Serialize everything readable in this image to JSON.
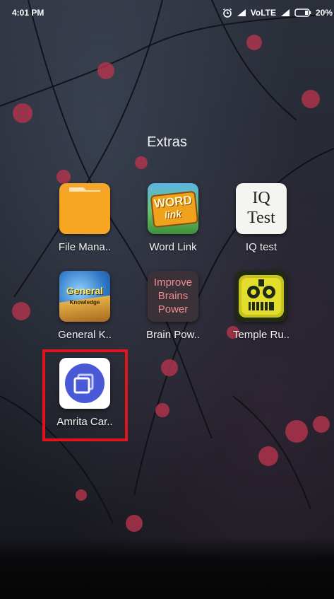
{
  "status_bar": {
    "time": "4:01 PM",
    "network": "VoLTE",
    "battery": "20%"
  },
  "folder": {
    "title": "Extras"
  },
  "apps": [
    {
      "label": "File Mana..",
      "icon": "folder-icon"
    },
    {
      "label": "Word Link",
      "icon": "word-link-icon",
      "icon_text_1": "WORD",
      "icon_text_2": "link"
    },
    {
      "label": "IQ test",
      "icon": "iq-test-icon",
      "icon_text_1": "IQ",
      "icon_text_2": "Test"
    },
    {
      "label": "General K..",
      "icon": "general-knowledge-icon",
      "icon_text_1": "General",
      "icon_text_2": "Knowledge"
    },
    {
      "label": "Brain Pow..",
      "icon": "brain-power-icon",
      "icon_text_1": "Improve",
      "icon_text_2": "Brains",
      "icon_text_3": "Power"
    },
    {
      "label": "Temple Ru..",
      "icon": "temple-run-icon"
    },
    {
      "label": "Amrita Car..",
      "icon": "amrita-cards-icon"
    }
  ],
  "highlight_color": "#e0151b"
}
